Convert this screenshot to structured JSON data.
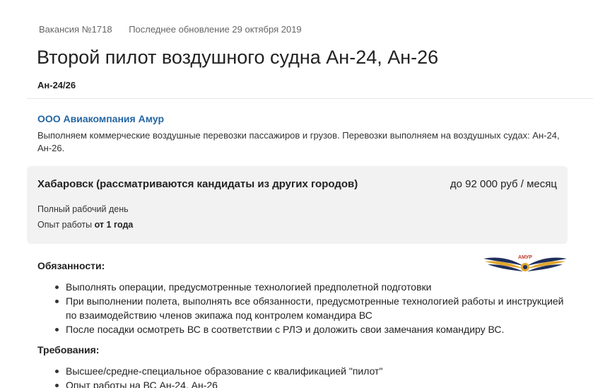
{
  "meta": {
    "vacancy_number": "Вакансия №1718",
    "last_update": "Последнее обновление 29 октября 2019"
  },
  "title": "Второй пилот воздушного судна Ан-24, Ан-26",
  "subtitle": "Ан-24/26",
  "company": {
    "name": "ООО Авиакомпания Амур",
    "description": "Выполняем коммерческие воздушные перевозки пассажиров и грузов. Перевозки выполняем на воздушных судах: Ан-24, Ан-26."
  },
  "info": {
    "city": "Хабаровск (рассматриваются кандидаты из других городов)",
    "salary": "до 92 000 руб / месяц",
    "schedule": "Полный рабочий день",
    "experience_label": "Опыт работы",
    "experience_value": "от 1 года"
  },
  "logo": {
    "text": "АМУР",
    "colors": {
      "navy": "#1f2f5c",
      "gold": "#e0a82e",
      "red": "#c0392b"
    }
  },
  "duties": {
    "heading": "Обязанности:",
    "items": [
      "Выполнять операции, предусмотренные технологией предполетной подготовки",
      "При выполнении полета, выполнять все обязанности, предусмотренные технологией работы и инструкцией по взаимодействию членов экипажа под контролем командира ВС",
      "После посадки осмотреть ВС в соответствии с РЛЭ и доложить свои замечания командиру ВС."
    ]
  },
  "requirements": {
    "heading": "Требования:",
    "items": [
      "Высшее/средне-специальное образование с квалификацией \"пилот\"",
      "Опыт работы на ВС Ан-24, Ан-26"
    ]
  },
  "colors": {
    "link": "#2466a3",
    "info_box_bg": "#f2f2f2",
    "muted_text": "#666666"
  }
}
